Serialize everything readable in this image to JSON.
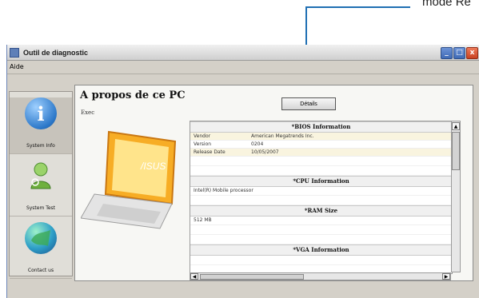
{
  "callout": {
    "text": "mode Re"
  },
  "window": {
    "title": "Outil de diagnostic",
    "controls": [
      "_",
      "□",
      "x"
    ]
  },
  "menu": {
    "help": "Aide"
  },
  "sidebar": {
    "items": [
      {
        "label": "System Info",
        "icon": "info-icon"
      },
      {
        "label": "System Test",
        "icon": "test-user-icon"
      },
      {
        "label": "Contact us",
        "icon": "globe-icon"
      }
    ]
  },
  "content": {
    "title": "A propos de ce PC",
    "small_label": "Exec",
    "details_button": "Détails",
    "sections": [
      {
        "heading": "*BIOS Information",
        "rows": [
          {
            "key": "Vendor",
            "value": "American Megatrends Inc."
          },
          {
            "key": "Version",
            "value": "0204"
          },
          {
            "key": "Release Date",
            "value": "10/05/2007"
          }
        ]
      },
      {
        "heading": "*CPU Information",
        "lines": [
          "Intel(R) Mobile processor"
        ]
      },
      {
        "heading": "*RAM Size",
        "lines": [
          "512 MB"
        ]
      },
      {
        "heading": "*VGA Information",
        "lines": []
      }
    ]
  },
  "colors": {
    "callout": "#1f6fb3",
    "window_bg": "#d4d0c8",
    "panel_bg": "#f7f7f4"
  }
}
